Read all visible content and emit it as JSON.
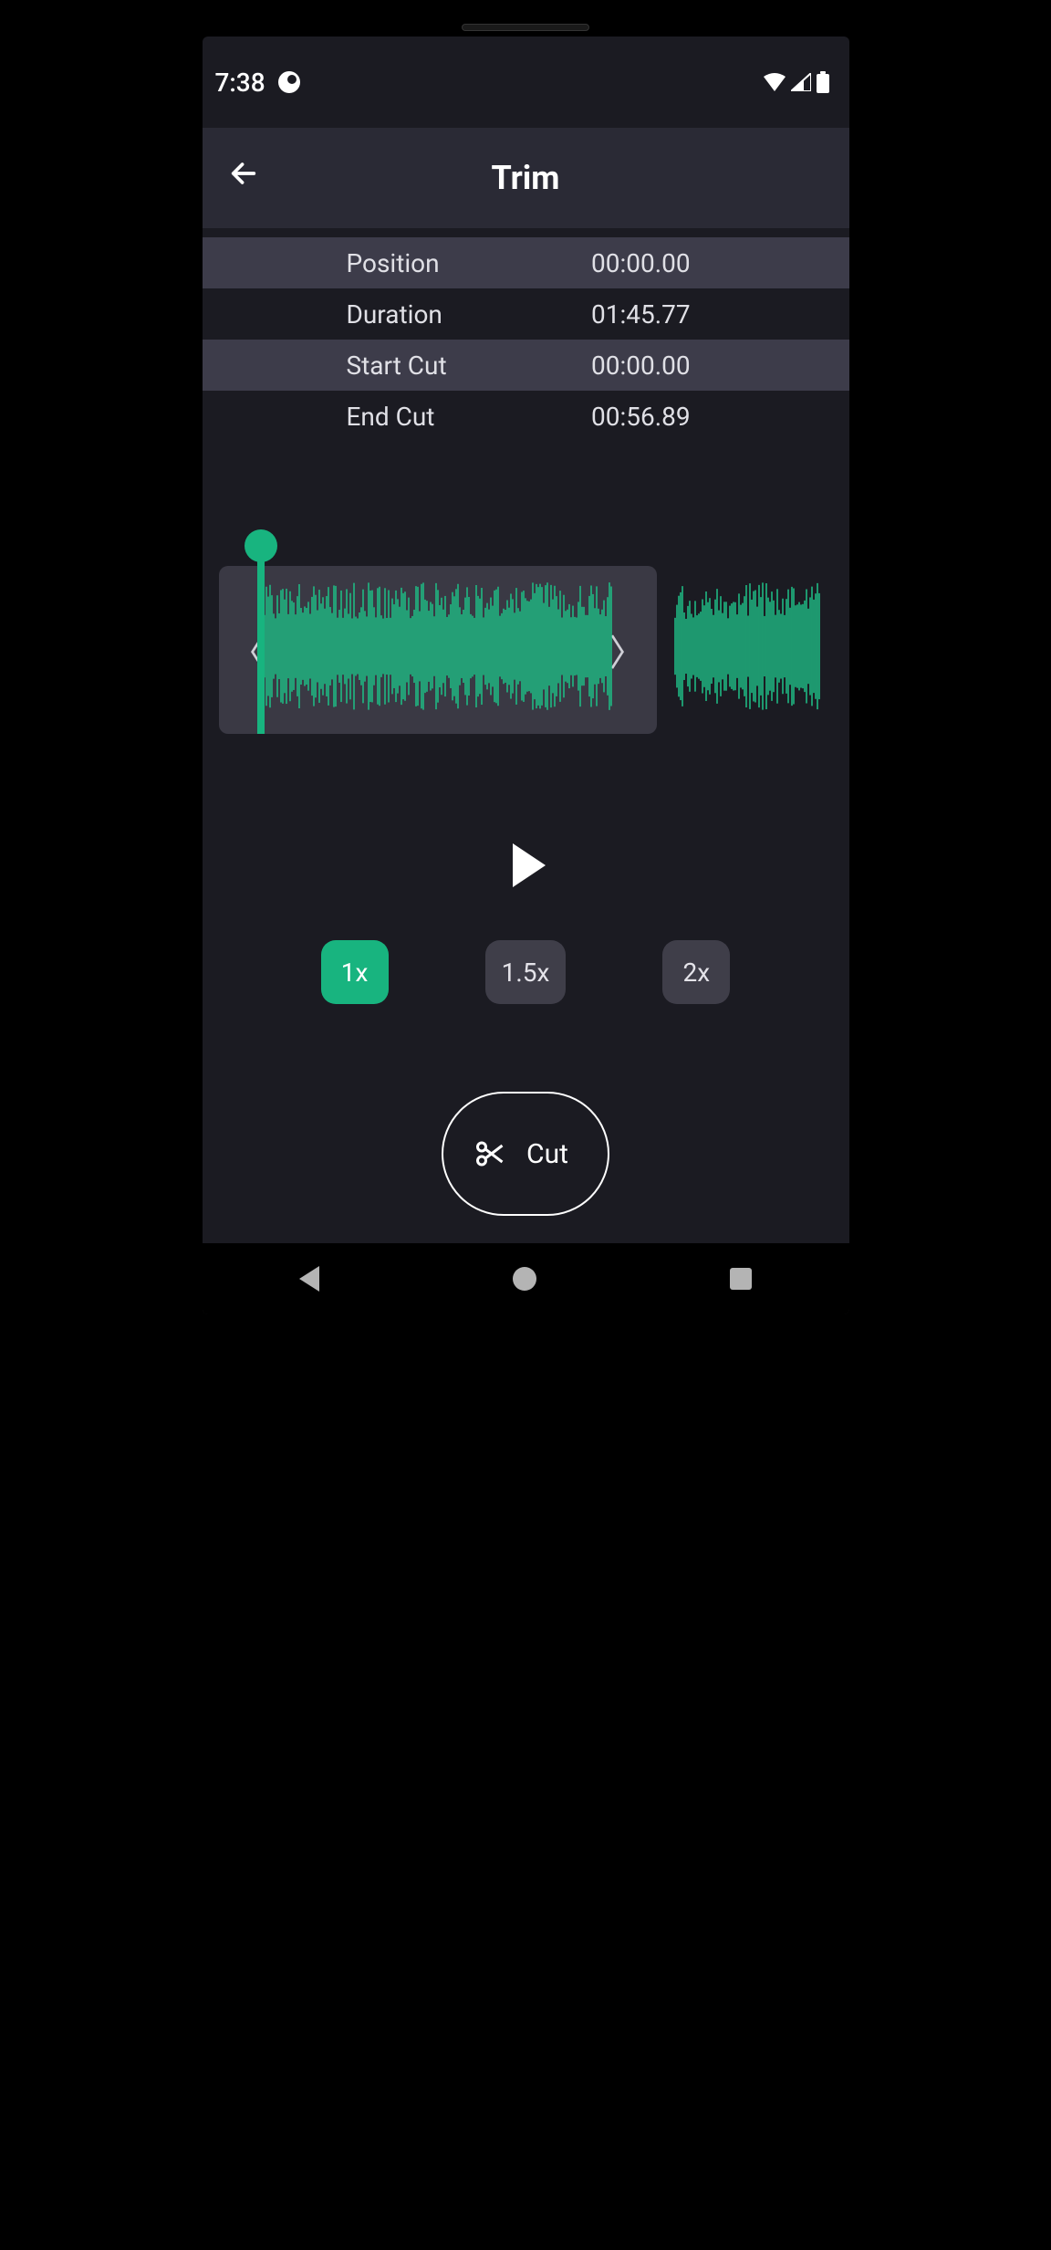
{
  "status": {
    "time": "7:38"
  },
  "header": {
    "title": "Trim"
  },
  "info": {
    "rows": [
      {
        "label": "Position",
        "value": "00:00.00"
      },
      {
        "label": "Duration",
        "value": "01:45.77"
      },
      {
        "label": "Start Cut",
        "value": "00:00.00"
      },
      {
        "label": "End Cut",
        "value": "00:56.89"
      }
    ]
  },
  "speeds": [
    {
      "label": "1x",
      "active": true
    },
    {
      "label": "1.5x",
      "active": false
    },
    {
      "label": "2x",
      "active": false
    }
  ],
  "cut": {
    "label": "Cut"
  },
  "accent": "#18b47f"
}
